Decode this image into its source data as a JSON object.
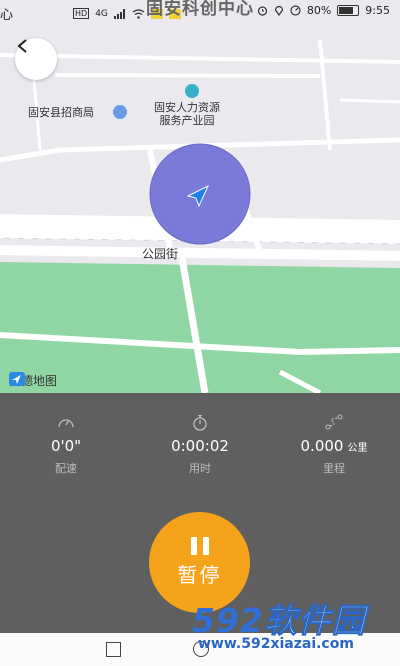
{
  "status_bar": {
    "left_glyph": "心",
    "network_type": "HD",
    "signal_label": "4G",
    "app_title": "固安科创中心",
    "battery_percent": "80%",
    "time": "9:55"
  },
  "map": {
    "poi_investment_bureau": "固安县招商局",
    "poi_hr_park_line1": "固安人力资源",
    "poi_hr_park_line2": "服务产业园",
    "street_name": "公园街",
    "provider_logo_text": "高德地图",
    "colors": {
      "road": "#ffffff",
      "block": "#e9e9ee",
      "park": "#8fd6a4",
      "accuracy_circle": "#7a7ad8",
      "location_arrow": "#1c7ee6"
    }
  },
  "stats": {
    "pace": {
      "value": "0'0\"",
      "label": "配速",
      "icon": "speedometer-icon"
    },
    "duration": {
      "value": "0:00:02",
      "label": "用时",
      "icon": "stopwatch-icon"
    },
    "distance": {
      "value": "0.000",
      "unit": "公里",
      "label": "里程",
      "icon": "route-icon"
    }
  },
  "controls": {
    "pause_label": "暂停",
    "pause_color": "#f5a31a"
  },
  "watermark": {
    "brand_num": "592",
    "brand_text": "软件园",
    "url": "www.592xiazai.com"
  }
}
